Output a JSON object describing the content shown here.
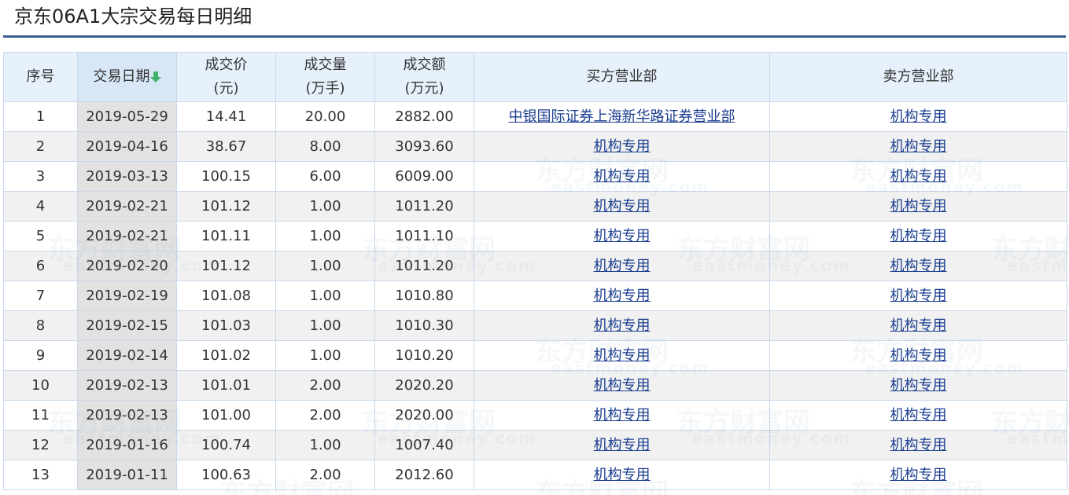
{
  "page": {
    "title": "京东06A1大宗交易每日明细"
  },
  "table": {
    "headers": {
      "index": "序号",
      "date": "交易日期",
      "price_line1": "成交价",
      "price_line2": "(元)",
      "volume_line1": "成交量",
      "volume_line2": "(万手)",
      "amount_line1": "成交额",
      "amount_line2": "(万元)",
      "buyer": "买方营业部",
      "seller": "卖方营业部"
    },
    "sort_icon": "arrow-down-icon",
    "sort_color": "#3fb36a",
    "rows": [
      {
        "index": "1",
        "date": "2019-05-29",
        "price": "14.41",
        "volume": "20.00",
        "amount": "2882.00",
        "buyer": "中银国际证券上海新华路证券营业部",
        "seller": "机构专用"
      },
      {
        "index": "2",
        "date": "2019-04-16",
        "price": "38.67",
        "volume": "8.00",
        "amount": "3093.60",
        "buyer": "机构专用",
        "seller": "机构专用"
      },
      {
        "index": "3",
        "date": "2019-03-13",
        "price": "100.15",
        "volume": "6.00",
        "amount": "6009.00",
        "buyer": "机构专用",
        "seller": "机构专用"
      },
      {
        "index": "4",
        "date": "2019-02-21",
        "price": "101.12",
        "volume": "1.00",
        "amount": "1011.20",
        "buyer": "机构专用",
        "seller": "机构专用"
      },
      {
        "index": "5",
        "date": "2019-02-21",
        "price": "101.11",
        "volume": "1.00",
        "amount": "1011.10",
        "buyer": "机构专用",
        "seller": "机构专用"
      },
      {
        "index": "6",
        "date": "2019-02-20",
        "price": "101.12",
        "volume": "1.00",
        "amount": "1011.20",
        "buyer": "机构专用",
        "seller": "机构专用"
      },
      {
        "index": "7",
        "date": "2019-02-19",
        "price": "101.08",
        "volume": "1.00",
        "amount": "1010.80",
        "buyer": "机构专用",
        "seller": "机构专用"
      },
      {
        "index": "8",
        "date": "2019-02-15",
        "price": "101.03",
        "volume": "1.00",
        "amount": "1010.30",
        "buyer": "机构专用",
        "seller": "机构专用"
      },
      {
        "index": "9",
        "date": "2019-02-14",
        "price": "101.02",
        "volume": "1.00",
        "amount": "1010.20",
        "buyer": "机构专用",
        "seller": "机构专用"
      },
      {
        "index": "10",
        "date": "2019-02-13",
        "price": "101.01",
        "volume": "2.00",
        "amount": "2020.20",
        "buyer": "机构专用",
        "seller": "机构专用"
      },
      {
        "index": "11",
        "date": "2019-02-13",
        "price": "101.00",
        "volume": "2.00",
        "amount": "2020.00",
        "buyer": "机构专用",
        "seller": "机构专用"
      },
      {
        "index": "12",
        "date": "2019-01-16",
        "price": "100.74",
        "volume": "1.00",
        "amount": "1007.40",
        "buyer": "机构专用",
        "seller": "机构专用"
      },
      {
        "index": "13",
        "date": "2019-01-11",
        "price": "100.63",
        "volume": "2.00",
        "amount": "2012.60",
        "buyer": "机构专用",
        "seller": "机构专用"
      }
    ]
  },
  "watermark": {
    "cn": "东方财富网",
    "en": "eastmoney.com"
  },
  "colors": {
    "header_bg": "#e7f1fb",
    "border": "#c9d9ea",
    "title_underline": "#3c5d92",
    "link": "#1a3d8f",
    "alt_row": "#f1f1f1",
    "date_column": "#e2e2e2"
  }
}
